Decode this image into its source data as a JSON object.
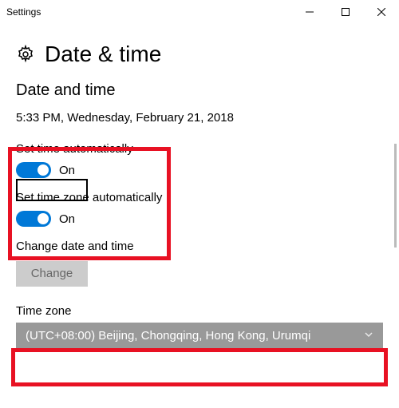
{
  "window": {
    "title": "Settings"
  },
  "page": {
    "gear_icon": "gear-icon",
    "title": "Date & time",
    "section": "Date and time",
    "current_datetime": "5:33 PM, Wednesday, February 21, 2018"
  },
  "settings": {
    "auto_time": {
      "label": "Set time automatically",
      "state": "On"
    },
    "auto_tz": {
      "label": "Set time zone automatically",
      "state": "On"
    },
    "change": {
      "label": "Change date and time",
      "button": "Change"
    },
    "timezone": {
      "label": "Time zone",
      "selected": "(UTC+08:00) Beijing, Chongqing, Hong Kong, Urumqi"
    }
  },
  "colors": {
    "accent": "#0078D7",
    "highlight": "#E81123"
  }
}
